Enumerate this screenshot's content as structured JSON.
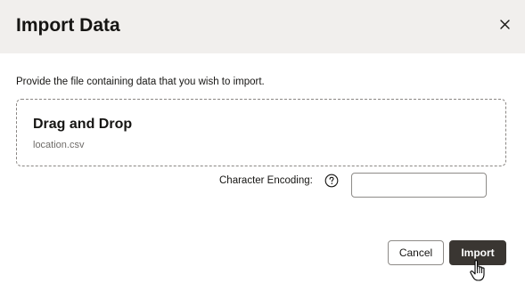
{
  "dialog": {
    "title": "Import Data",
    "close_icon": "close-icon",
    "instruction": "Provide the file containing data that you wish to import.",
    "drop_zone": {
      "title": "Drag and Drop",
      "file_name": "location.csv"
    },
    "encoding": {
      "label": "Character Encoding:",
      "help_icon": "question-circle-icon",
      "value": ""
    },
    "buttons": {
      "cancel_label": "Cancel",
      "import_label": "Import"
    }
  },
  "colors": {
    "header_bg": "#f1efed",
    "primary_button": "#3a3632",
    "text": "#161513",
    "muted_text": "#6f6c69"
  }
}
